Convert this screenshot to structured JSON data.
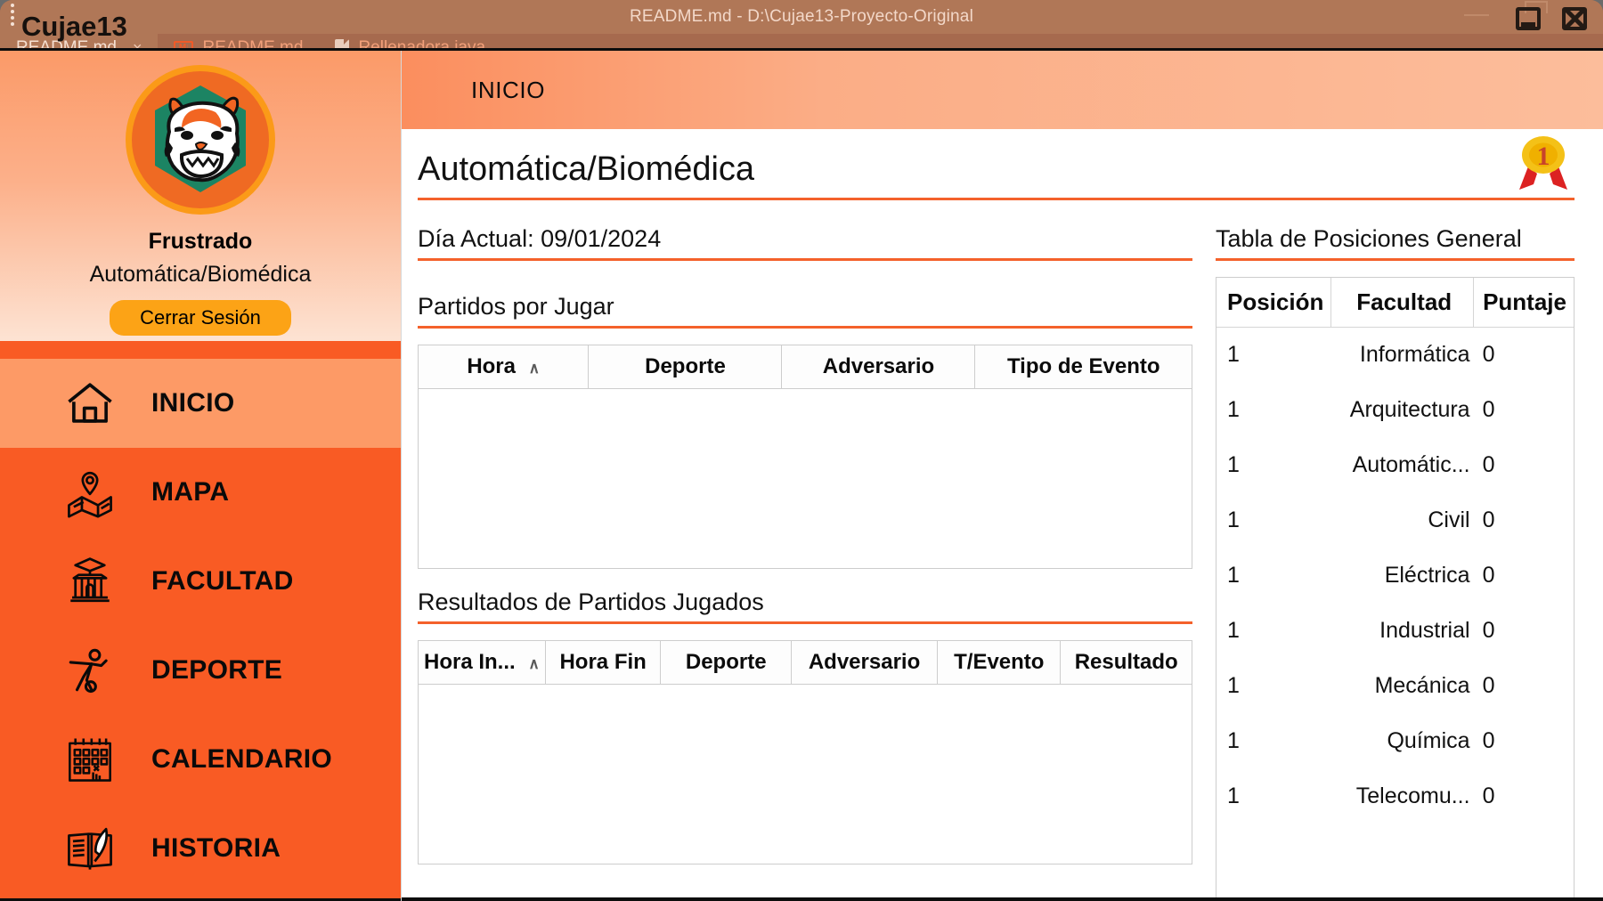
{
  "background_window": {
    "title": "README.md - D:\\Cujae13-Proyecto-Original",
    "overlay_label": "Cujae13",
    "kebab_icon": "kebab-menu-icon",
    "tabs": [
      {
        "label": "README.md",
        "close": "×",
        "icon": "",
        "active": true
      },
      {
        "label": "README.md",
        "close": "",
        "icon": "markdown-icon",
        "active": false
      },
      {
        "label": "Rellenadora.java",
        "close": "",
        "icon": "java-file-icon",
        "active": false
      }
    ],
    "controls": {
      "minimize": "minimize-icon",
      "close": "close-icon"
    }
  },
  "sidebar": {
    "logo_icon": "tiger-logo-icon",
    "profile_name": "Frustrado",
    "profile_faculty": "Automática/Biomédica",
    "logout_label": "Cerrar Sesión",
    "items": [
      {
        "label": "INICIO",
        "icon": "home-icon",
        "active": true
      },
      {
        "label": "MAPA",
        "icon": "map-icon",
        "active": false
      },
      {
        "label": "FACULTAD",
        "icon": "university-icon",
        "active": false
      },
      {
        "label": "DEPORTE",
        "icon": "soccer-player-icon",
        "active": false
      },
      {
        "label": "CALENDARIO",
        "icon": "calendar-icon",
        "active": false
      },
      {
        "label": "HISTORIA",
        "icon": "open-book-quill-icon",
        "active": false
      }
    ]
  },
  "content": {
    "breadcrumb": "INICIO",
    "page_title": "Automática/Biomédica",
    "medal": {
      "icon": "first-place-medal-icon",
      "rank": "1"
    },
    "current_day_label": "Día Actual: 09/01/2024",
    "sections": {
      "upcoming": {
        "label": "Partidos por Jugar",
        "columns": [
          {
            "label": "Hora",
            "sorted": true,
            "caret": "∧"
          },
          {
            "label": "Deporte",
            "sorted": false,
            "caret": ""
          },
          {
            "label": "Adversario",
            "sorted": false,
            "caret": ""
          },
          {
            "label": "Tipo de Evento",
            "sorted": false,
            "caret": ""
          }
        ],
        "rows": []
      },
      "results": {
        "label": "Resultados de Partidos Jugados",
        "columns": [
          {
            "label": "Hora In...",
            "sorted": true,
            "caret": "∧"
          },
          {
            "label": "Hora Fin",
            "sorted": false,
            "caret": ""
          },
          {
            "label": "Deporte",
            "sorted": false,
            "caret": ""
          },
          {
            "label": "Adversario",
            "sorted": false,
            "caret": ""
          },
          {
            "label": "T/Evento",
            "sorted": false,
            "caret": ""
          },
          {
            "label": "Resultado",
            "sorted": false,
            "caret": ""
          }
        ],
        "rows": []
      },
      "standings": {
        "label": "Tabla de Posiciones General",
        "columns": [
          "Posición",
          "Facultad",
          "Puntaje"
        ],
        "rows": [
          {
            "posicion": "1",
            "facultad": "Informática",
            "puntaje": "0"
          },
          {
            "posicion": "1",
            "facultad": "Arquitectura",
            "puntaje": "0"
          },
          {
            "posicion": "1",
            "facultad": "Automátic...",
            "puntaje": "0"
          },
          {
            "posicion": "1",
            "facultad": "Civil",
            "puntaje": "0"
          },
          {
            "posicion": "1",
            "facultad": "Eléctrica",
            "puntaje": "0"
          },
          {
            "posicion": "1",
            "facultad": "Industrial",
            "puntaje": "0"
          },
          {
            "posicion": "1",
            "facultad": "Mecánica",
            "puntaje": "0"
          },
          {
            "posicion": "1",
            "facultad": "Química",
            "puntaje": "0"
          },
          {
            "posicion": "1",
            "facultad": "Telecomu...",
            "puntaje": "0"
          }
        ]
      }
    }
  },
  "colors": {
    "brand_orange": "#f95b24",
    "accent_rule": "#f4612b",
    "active_nav": "#fd9a66",
    "logout_yellow": "#fca316",
    "logo_ring": "#fb9a18",
    "bg_window": "#b07757",
    "medal_gold": "#f4c117",
    "medal_ribbon": "#dc2222"
  }
}
